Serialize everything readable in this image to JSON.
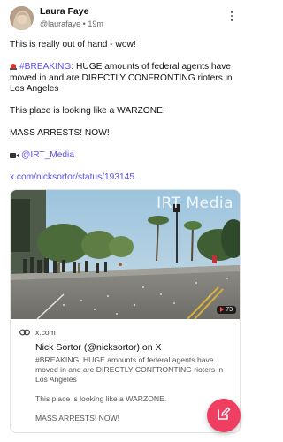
{
  "post": {
    "author_name": "Laura Faye",
    "handle": "@laurafaye",
    "separator": " • ",
    "time": "19m",
    "paragraphs": [
      {
        "text": "This is really out of hand - wow!"
      },
      {
        "hashtag": "#BREAKING",
        "text": ": HUGE amounts of federal agents have moved in and are DIRECTLY CONFRONTING rioters in Los Angeles"
      },
      {
        "text": "This place is looking like a WARZONE."
      },
      {
        "text": "MASS ARRESTS! NOW!"
      },
      {
        "mention": "@IRT_Media"
      },
      {
        "link": "x.com/nicksortor/status/193145..."
      }
    ]
  },
  "card": {
    "watermark": "IRT Media",
    "video_badge": "73",
    "domain": "x.com",
    "title": "Nick Sortor (@nicksortor) on X",
    "description": [
      "#BREAKING: HUGE amounts of federal agents have moved in and are DIRECTLY CONFRONTING rioters in Los Angeles",
      "This place is looking like a WARZONE.",
      "MASS ARRESTS! NOW!"
    ]
  },
  "colors": {
    "accent_link": "#5b4ee6",
    "fab": "#ef3e61"
  },
  "icons": {
    "more": "vertical-dots-icon",
    "siren": "police-siren-emoji",
    "camera": "video-camera-emoji",
    "link": "link-icon",
    "compose": "compose-pencil-icon"
  }
}
